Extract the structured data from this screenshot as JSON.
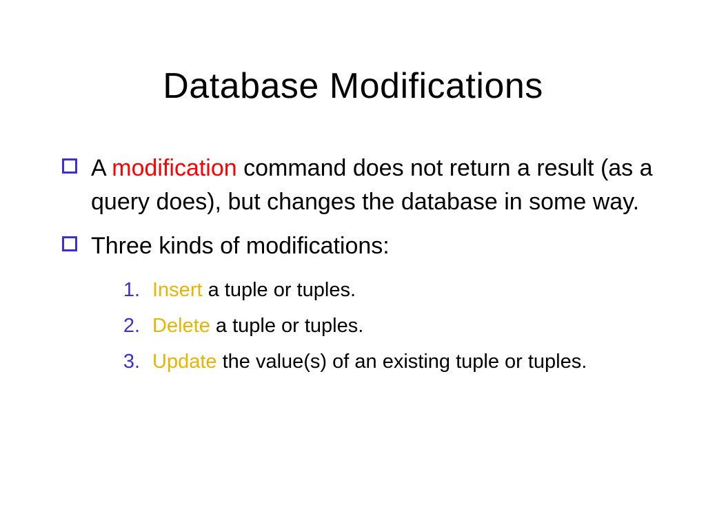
{
  "title": "Database Modifications",
  "bullets": [
    {
      "pre": "A ",
      "hl": "modification",
      "post": " command does not return a result (as a query does), but changes the database in some way."
    },
    {
      "pre": "Three kinds of modifications:",
      "hl": "",
      "post": ""
    }
  ],
  "numbered": [
    {
      "n": "1.",
      "hl": "Insert",
      "rest": "  a tuple or tuples."
    },
    {
      "n": "2.",
      "hl": "Delete",
      "rest": "  a tuple or tuples."
    },
    {
      "n": "3.",
      "hl": "Update",
      "rest": "  the value(s) of an existing tuple or tuples."
    }
  ]
}
